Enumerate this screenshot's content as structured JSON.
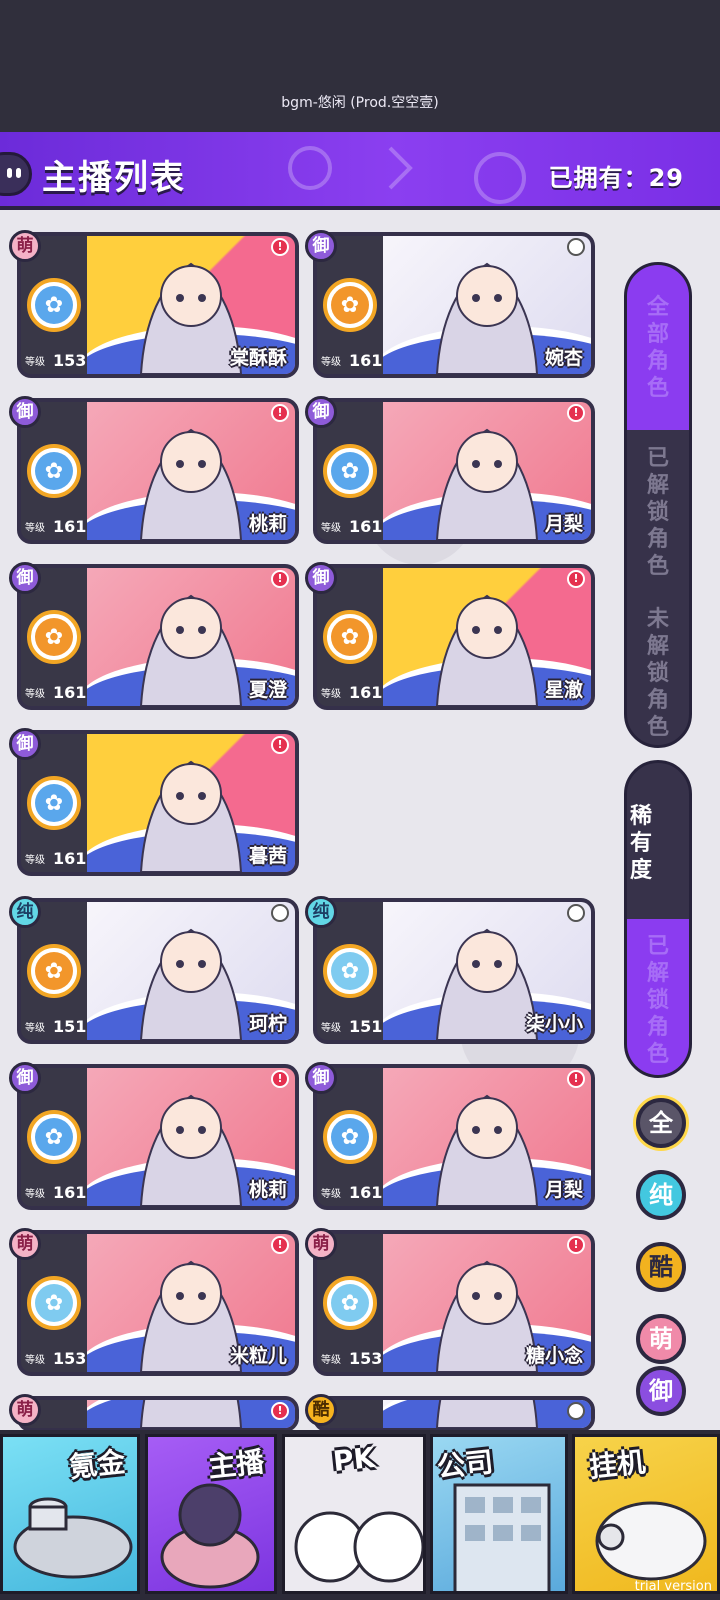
{
  "top": {
    "bgm": "bgm-悠闲 (Prod.空空壹)"
  },
  "header": {
    "title": "主播列表",
    "owned": "已拥有：29"
  },
  "cards": [
    {
      "type": "萌",
      "level": "153",
      "level_label": "等级",
      "name": "棠酥酥",
      "art": "yellow",
      "skill": "blue",
      "alert": "!"
    },
    {
      "type": "御",
      "level": "161",
      "level_label": "等级",
      "name": "婉杏",
      "art": "light",
      "skill": "orange",
      "alert": ""
    },
    {
      "type": "御",
      "level": "161",
      "level_label": "等级",
      "name": "桃莉",
      "art": "pink",
      "skill": "blue",
      "alert": "!"
    },
    {
      "type": "御",
      "level": "161",
      "level_label": "等级",
      "name": "月梨",
      "art": "pink",
      "skill": "blue",
      "alert": "!"
    },
    {
      "type": "御",
      "level": "161",
      "level_label": "等级",
      "name": "夏澄",
      "art": "pink",
      "skill": "orange",
      "alert": "!"
    },
    {
      "type": "御",
      "level": "161",
      "level_label": "等级",
      "name": "星澈",
      "art": "yellow",
      "skill": "orange",
      "alert": "!"
    },
    {
      "type": "御",
      "level": "161",
      "level_label": "等级",
      "name": "暮茜",
      "art": "yellow",
      "skill": "blue",
      "alert": "!"
    },
    {
      "type": "纯",
      "level": "151",
      "level_label": "等级",
      "name": "珂柠",
      "art": "light",
      "skill": "orange",
      "alert": ""
    },
    {
      "type": "纯",
      "level": "151",
      "level_label": "等级",
      "name": "柒小小",
      "art": "light",
      "skill": "lightblue",
      "alert": ""
    },
    {
      "type": "御",
      "level": "161",
      "level_label": "等级",
      "name": "桃莉",
      "art": "pink",
      "skill": "blue",
      "alert": "!"
    },
    {
      "type": "御",
      "level": "161",
      "level_label": "等级",
      "name": "月梨",
      "art": "pink",
      "skill": "blue",
      "alert": "!"
    },
    {
      "type": "萌",
      "level": "153",
      "level_label": "等级",
      "name": "米粒儿",
      "art": "pink",
      "skill": "lightblue",
      "alert": "!"
    },
    {
      "type": "萌",
      "level": "153",
      "level_label": "等级",
      "name": "糖小念",
      "art": "pink",
      "skill": "lightblue",
      "alert": "!"
    },
    {
      "type": "萌",
      "level": "",
      "level_label": "",
      "name": "",
      "art": "pink",
      "skill": "",
      "alert": "!"
    },
    {
      "type": "酷",
      "level": "",
      "level_label": "",
      "name": "",
      "art": "light",
      "skill": "",
      "alert": ""
    }
  ],
  "side": {
    "tabs": [
      "全部角色",
      "已解锁角色",
      "未解锁角色"
    ],
    "rarity_title": "稀有度",
    "rarity_value": "已解锁角色",
    "filters": [
      "全",
      "纯",
      "酷",
      "萌",
      "御"
    ]
  },
  "bottom_nav": [
    "氪金",
    "主播",
    "PK",
    "公司",
    "挂机"
  ],
  "watermark": "trial version"
}
